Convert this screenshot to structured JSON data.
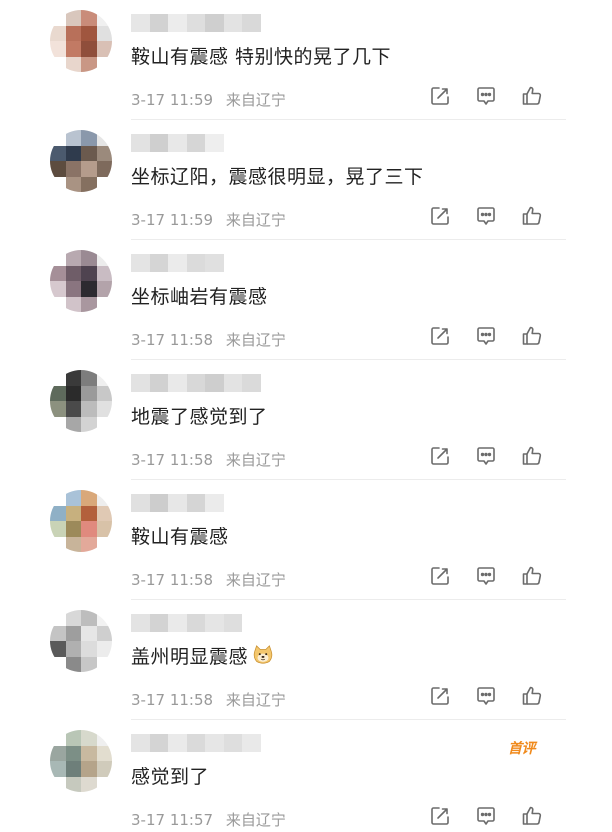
{
  "comments": [
    {
      "text": "鞍山有震感 特别快的晃了几下",
      "date": "3-17",
      "time": "11:59",
      "location": "来自辽宁",
      "avatar_colors": [
        "#ffffff",
        "#d9c7bd",
        "#c98c7a",
        "#f0f0f0",
        "#e9d9cf",
        "#b8705a",
        "#a0563f",
        "#e0e0e0",
        "#f2e2da",
        "#c27a64",
        "#8f4e3b",
        "#d9c0b5",
        "#ffffff",
        "#e8d6cc",
        "#c99785",
        "#ffffff"
      ],
      "username_colors": [
        "#e6e6e6",
        "#d2d2d2",
        "#ececec",
        "#dedede",
        "#cfcfcf",
        "#e3e3e3",
        "#d9d9d9"
      ]
    },
    {
      "text": "坐标辽阳，震感很明显，晃了三下",
      "date": "3-17",
      "time": "11:59",
      "location": "来自辽宁",
      "avatar_colors": [
        "#ffffff",
        "#b9c3d0",
        "#8a98ab",
        "#e5e5e5",
        "#4b5a6e",
        "#2f3b4d",
        "#6b5a4e",
        "#9b8a7c",
        "#5d4c3f",
        "#8a7366",
        "#b59c8c",
        "#7e6a5c",
        "#ffffff",
        "#a99383",
        "#857060",
        "#ffffff"
      ],
      "username_colors": [
        "#e2e2e2",
        "#cfcfcf",
        "#e8e8e8",
        "#d6d6d6",
        "#eeeeee",
        "#ffffff",
        "#ffffff"
      ]
    },
    {
      "text": "坐标岫岩有震感",
      "date": "3-17",
      "time": "11:58",
      "location": "来自辽宁",
      "avatar_colors": [
        "#ffffff",
        "#b8a9b0",
        "#9a8a93",
        "#ececec",
        "#a58f98",
        "#6f5d68",
        "#4f4350",
        "#c9bcc3",
        "#d6c8ce",
        "#8a7580",
        "#2c2a30",
        "#b3a3aa",
        "#ffffff",
        "#d1c3c9",
        "#a9979f",
        "#ffffff"
      ],
      "username_colors": [
        "#e4e4e4",
        "#d5d5d5",
        "#ebebeb",
        "#dbdbdb",
        "#e0e0e0",
        "#ffffff",
        "#ffffff"
      ]
    },
    {
      "text": "地震了感觉到了",
      "date": "3-17",
      "time": "11:58",
      "location": "来自辽宁",
      "avatar_colors": [
        "#ffffff",
        "#3a3a3a",
        "#7d7d7d",
        "#efefef",
        "#5e6a5c",
        "#2b2b2b",
        "#9a9a9a",
        "#c8c8c8",
        "#8c917f",
        "#4a4a4a",
        "#bcbcbc",
        "#e0e0e0",
        "#ffffff",
        "#a7a7a7",
        "#d3d3d3",
        "#ffffff"
      ],
      "username_colors": [
        "#e2e2e2",
        "#d1d1d1",
        "#e9e9e9",
        "#d8d8d8",
        "#cecece",
        "#e3e3e3",
        "#dadada"
      ]
    },
    {
      "text": "鞍山有震感",
      "date": "3-17",
      "time": "11:58",
      "location": "来自辽宁",
      "avatar_colors": [
        "#ffffff",
        "#a9c2d8",
        "#d9a87a",
        "#eeeeee",
        "#8fb0c6",
        "#c7b07e",
        "#b3603c",
        "#e0c9b4",
        "#c9d3b6",
        "#9c8a5a",
        "#e08a7e",
        "#d8c2a8",
        "#ffffff",
        "#c8b49a",
        "#e3a99a",
        "#ffffff"
      ],
      "username_colors": [
        "#e0e0e0",
        "#cdcdcd",
        "#e7e7e7",
        "#d5d5d5",
        "#ebebeb",
        "#ffffff",
        "#ffffff"
      ]
    },
    {
      "text": "盖州明显震感",
      "date": "3-17",
      "time": "11:58",
      "location": "来自辽宁",
      "avatar_colors": [
        "#ffffff",
        "#d8d8d8",
        "#bdbdbd",
        "#f2f2f2",
        "#c4c4c4",
        "#9e9e9e",
        "#e6e6e6",
        "#cfcfcf",
        "#5a5a5a",
        "#b0b0b0",
        "#dcdcdc",
        "#ececec",
        "#ffffff",
        "#8a8a8a",
        "#c7c7c7",
        "#ffffff"
      ],
      "username_colors": [
        "#e3e3e3",
        "#d3d3d3",
        "#eaeaea",
        "#d9d9d9",
        "#e5e5e5",
        "#dedede",
        "#ffffff"
      ]
    },
    {
      "text": "感觉到了",
      "date": "3-17",
      "time": "11:57",
      "location": "来自辽宁",
      "badge": "首评",
      "avatar_colors": [
        "#ffffff",
        "#b9c6b6",
        "#d7d9cc",
        "#efefef",
        "#9aa6a0",
        "#7c8f86",
        "#c8b9a0",
        "#e2ddcf",
        "#a8b8b5",
        "#6e7f7a",
        "#b5a48a",
        "#d0cbbb",
        "#ffffff",
        "#c6c9be",
        "#dedad0",
        "#ffffff"
      ],
      "username_colors": [
        "#e4e4e4",
        "#d4d4d4",
        "#eaeaea",
        "#dadada",
        "#e6e6e6",
        "#dedede",
        "#e9e9e9"
      ]
    }
  ],
  "icons": {
    "forward": "share-edit-icon",
    "reply": "comment-bubble-icon",
    "like": "thumbs-up-icon",
    "emoji": "doge-emoji-icon"
  },
  "colors": {
    "text": "#222222",
    "meta": "#9a9a9a",
    "icon": "#6b6b6b",
    "badge": "#f08a1c",
    "divider": "#ececec"
  }
}
